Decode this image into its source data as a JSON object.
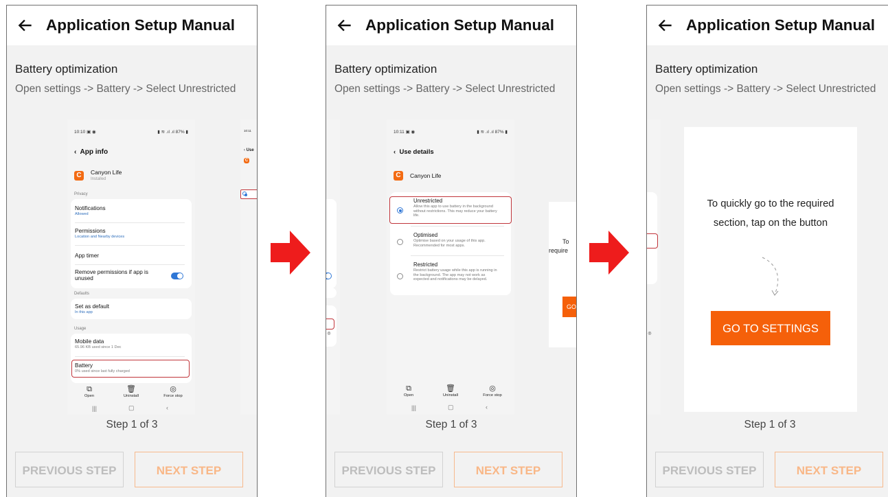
{
  "header": {
    "title": "Application Setup Manual"
  },
  "section": {
    "title": "Battery optimization",
    "subtitle": "Open settings -> Battery -> Select Unrestricted"
  },
  "step": {
    "label": "Step 1 of 3"
  },
  "buttons": {
    "previous": "PREVIOUS STEP",
    "next": "NEXT STEP"
  },
  "tip": {
    "text": "To quickly go to the required section, tap on the button",
    "button": "GO TO SETTINGS"
  },
  "colors": {
    "accent": "#f5600a",
    "highlight": "#c0343a",
    "toggle": "#2f77d6",
    "arrow": "#ee1c1c"
  },
  "shot1": {
    "time": "10:10",
    "battery": "87%",
    "title": "App info",
    "app_name": "Canyon Life",
    "app_status": "Installed",
    "privacy_label": "Privacy",
    "items": [
      {
        "title": "Notifications",
        "sub": "Allowed"
      },
      {
        "title": "Permissions",
        "sub": "Location and Nearby devices"
      },
      {
        "title": "App timer",
        "sub": ""
      },
      {
        "title": "Remove permissions if app is unused",
        "sub": ""
      }
    ],
    "defaults_label": "Defaults",
    "default_item": {
      "title": "Set as default",
      "sub": "In this app"
    },
    "usage_label": "Usage",
    "mobile_data": {
      "title": "Mobile data",
      "sub": "65.96 KB used since 1 Dec"
    },
    "battery_item": {
      "title": "Battery",
      "sub": "0% used since last fully charged"
    },
    "actions": [
      "Open",
      "Uninstall",
      "Force stop"
    ]
  },
  "shot2": {
    "time": "10:11",
    "battery": "87%",
    "title": "Use details",
    "app_name": "Canyon Life",
    "options": [
      {
        "title": "Unrestricted",
        "sub": "Allow this app to use battery in the background without restrictions. This may reduce your battery life."
      },
      {
        "title": "Optimised",
        "sub": "Optimise based on your usage of this app. Recommended for most apps."
      },
      {
        "title": "Restricted",
        "sub": "Restrict battery usage while this app is running in the background. The app may not work as expected and notifications may be delayed."
      }
    ],
    "actions": [
      "Open",
      "Uninstall",
      "Force stop"
    ]
  },
  "peek": {
    "status": "10:11",
    "title": "Use",
    "tip_fragment": "To",
    "tip_fragment2": "require",
    "button_fragment": "GO"
  }
}
